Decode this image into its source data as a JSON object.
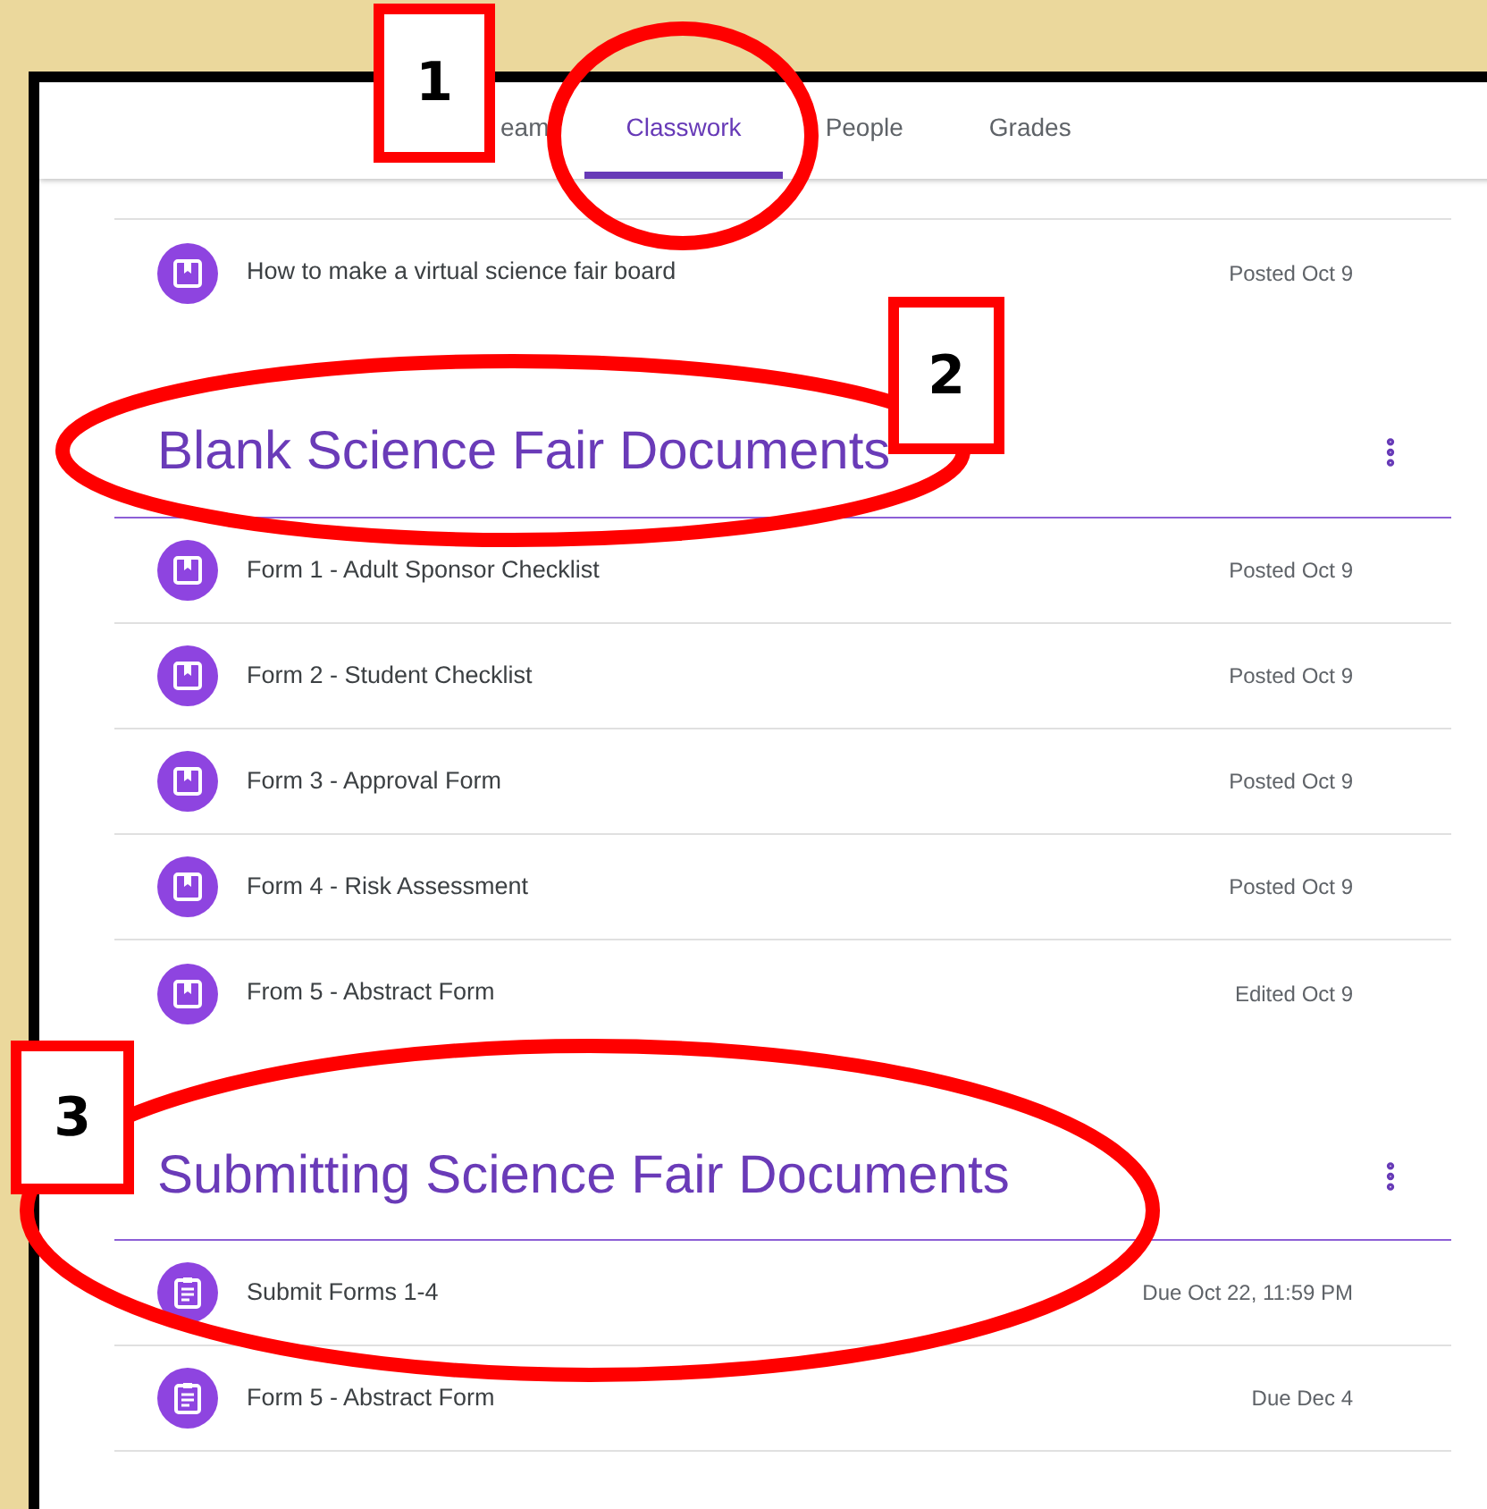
{
  "tabs": [
    {
      "label": "eam",
      "selected": false
    },
    {
      "label": "Classwork",
      "selected": true
    },
    {
      "label": "People",
      "selected": false
    },
    {
      "label": "Grades",
      "selected": false
    }
  ],
  "top_items": [
    {
      "kind": "material",
      "title": "How to make a virtual science fair board",
      "date": "Posted Oct 9"
    }
  ],
  "sections": [
    {
      "title": "Blank Science Fair Documents",
      "items": [
        {
          "kind": "material",
          "title": "Form 1 - Adult Sponsor Checklist",
          "date": "Posted Oct 9"
        },
        {
          "kind": "material",
          "title": "Form 2 - Student Checklist",
          "date": "Posted Oct 9"
        },
        {
          "kind": "material",
          "title": "Form 3 - Approval Form",
          "date": "Posted Oct 9"
        },
        {
          "kind": "material",
          "title": "Form 4 - Risk Assessment",
          "date": "Posted Oct 9"
        },
        {
          "kind": "material",
          "title": "From 5 - Abstract Form",
          "date": "Edited Oct 9"
        }
      ]
    },
    {
      "title": "Submitting Science Fair Documents",
      "items": [
        {
          "kind": "assignment",
          "title": "Submit Forms 1-4",
          "date": "Due Oct 22, 11:59 PM"
        },
        {
          "kind": "assignment",
          "title": "Form 5 - Abstract Form",
          "date": "Due Dec 4"
        }
      ]
    }
  ],
  "annotations": [
    {
      "number": "1"
    },
    {
      "number": "2"
    },
    {
      "number": "3"
    }
  ]
}
